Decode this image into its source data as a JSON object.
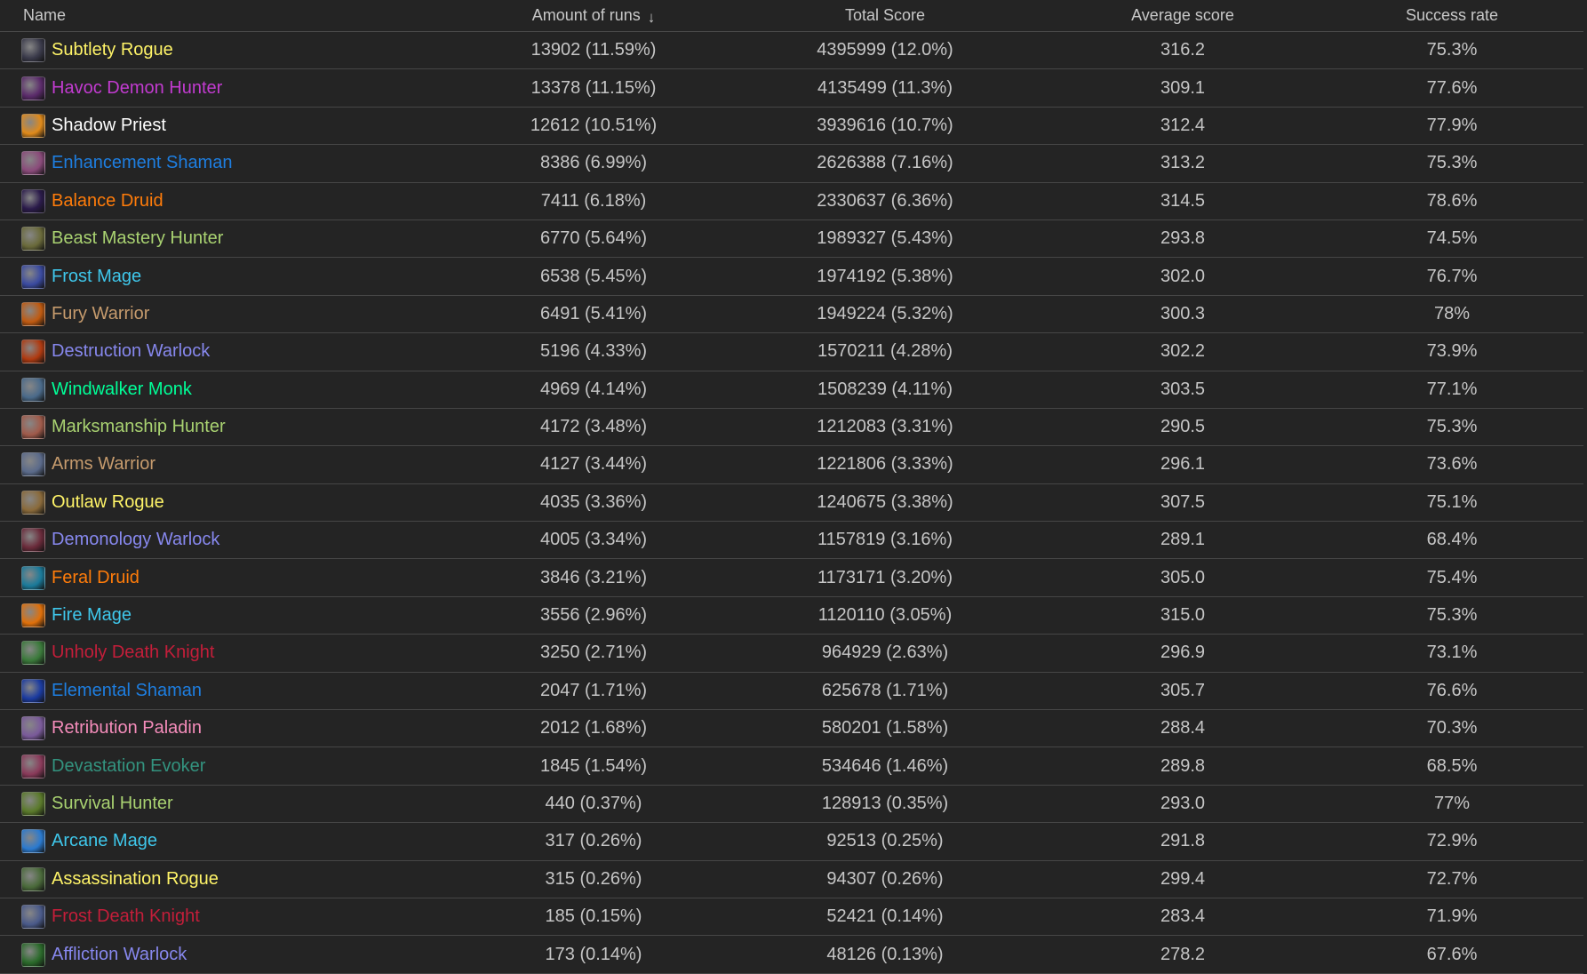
{
  "columns": {
    "name": "Name",
    "runs": "Amount of runs",
    "total": "Total Score",
    "avg": "Average score",
    "success": "Success rate"
  },
  "sort_icon": "arrow-down-icon",
  "rows": [
    {
      "name": "Subtlety Rogue",
      "color": "#fff468",
      "icon": "subtlety-rogue-icon",
      "icon_color": "#3a3a4a",
      "runs": "13902 (11.59%)",
      "total": "4395999 (12.0%)",
      "avg": "316.2",
      "success": "75.3%"
    },
    {
      "name": "Havoc Demon Hunter",
      "color": "#c23bd0",
      "icon": "havoc-demon-hunter-icon",
      "icon_color": "#5a2a6a",
      "runs": "13378 (11.15%)",
      "total": "4135499 (11.3%)",
      "avg": "309.1",
      "success": "77.6%"
    },
    {
      "name": "Shadow Priest",
      "color": "#ffffff",
      "icon": "shadow-priest-icon",
      "icon_color": "#e08a1a",
      "runs": "12612 (10.51%)",
      "total": "3939616 (10.7%)",
      "avg": "312.4",
      "success": "77.9%"
    },
    {
      "name": "Enhancement Shaman",
      "color": "#1e7ee0",
      "icon": "enhancement-shaman-icon",
      "icon_color": "#8a4a7a",
      "runs": "8386 (6.99%)",
      "total": "2626388 (7.16%)",
      "avg": "313.2",
      "success": "75.3%"
    },
    {
      "name": "Balance Druid",
      "color": "#ff7c0a",
      "icon": "balance-druid-icon",
      "icon_color": "#2a1a4a",
      "runs": "7411 (6.18%)",
      "total": "2330637 (6.36%)",
      "avg": "314.5",
      "success": "78.6%"
    },
    {
      "name": "Beast Mastery Hunter",
      "color": "#a9d271",
      "icon": "beast-mastery-hunter-icon",
      "icon_color": "#6a6a3a",
      "runs": "6770 (5.64%)",
      "total": "1989327 (5.43%)",
      "avg": "293.8",
      "success": "74.5%"
    },
    {
      "name": "Frost Mage",
      "color": "#3fc7eb",
      "icon": "frost-mage-icon",
      "icon_color": "#3a4aa0",
      "runs": "6538 (5.45%)",
      "total": "1974192 (5.38%)",
      "avg": "302.0",
      "success": "76.7%"
    },
    {
      "name": "Fury Warrior",
      "color": "#c69b6d",
      "icon": "fury-warrior-icon",
      "icon_color": "#c05a10",
      "runs": "6491 (5.41%)",
      "total": "1949224 (5.32%)",
      "avg": "300.3",
      "success": "78%"
    },
    {
      "name": "Destruction Warlock",
      "color": "#8788ee",
      "icon": "destruction-warlock-icon",
      "icon_color": "#b03a10",
      "runs": "5196 (4.33%)",
      "total": "1570211 (4.28%)",
      "avg": "302.2",
      "success": "73.9%"
    },
    {
      "name": "Windwalker Monk",
      "color": "#00ff98",
      "icon": "windwalker-monk-icon",
      "icon_color": "#4a6a8a",
      "runs": "4969 (4.14%)",
      "total": "1508239 (4.11%)",
      "avg": "303.5",
      "success": "77.1%"
    },
    {
      "name": "Marksmanship Hunter",
      "color": "#a9d271",
      "icon": "marksmanship-hunter-icon",
      "icon_color": "#a05a4a",
      "runs": "4172 (3.48%)",
      "total": "1212083 (3.31%)",
      "avg": "290.5",
      "success": "75.3%"
    },
    {
      "name": "Arms Warrior",
      "color": "#c69b6d",
      "icon": "arms-warrior-icon",
      "icon_color": "#5a6a8a",
      "runs": "4127 (3.44%)",
      "total": "1221806 (3.33%)",
      "avg": "296.1",
      "success": "73.6%"
    },
    {
      "name": "Outlaw Rogue",
      "color": "#fff468",
      "icon": "outlaw-rogue-icon",
      "icon_color": "#8a6a3a",
      "runs": "4035 (3.36%)",
      "total": "1240675 (3.38%)",
      "avg": "307.5",
      "success": "75.1%"
    },
    {
      "name": "Demonology Warlock",
      "color": "#8788ee",
      "icon": "demonology-warlock-icon",
      "icon_color": "#6a2a3a",
      "runs": "4005 (3.34%)",
      "total": "1157819 (3.16%)",
      "avg": "289.1",
      "success": "68.4%"
    },
    {
      "name": "Feral Druid",
      "color": "#ff7c0a",
      "icon": "feral-druid-icon",
      "icon_color": "#1a7a9a",
      "runs": "3846 (3.21%)",
      "total": "1173171 (3.20%)",
      "avg": "305.0",
      "success": "75.4%"
    },
    {
      "name": "Fire Mage",
      "color": "#3fc7eb",
      "icon": "fire-mage-icon",
      "icon_color": "#e0700a",
      "runs": "3556 (2.96%)",
      "total": "1120110 (3.05%)",
      "avg": "315.0",
      "success": "75.3%"
    },
    {
      "name": "Unholy Death Knight",
      "color": "#c41e3a",
      "icon": "unholy-death-knight-icon",
      "icon_color": "#3a7a3a",
      "runs": "3250 (2.71%)",
      "total": "964929 (2.63%)",
      "avg": "296.9",
      "success": "73.1%"
    },
    {
      "name": "Elemental Shaman",
      "color": "#1e7ee0",
      "icon": "elemental-shaman-icon",
      "icon_color": "#1a3aa0",
      "runs": "2047 (1.71%)",
      "total": "625678 (1.71%)",
      "avg": "305.7",
      "success": "76.6%"
    },
    {
      "name": "Retribution Paladin",
      "color": "#f48cba",
      "icon": "retribution-paladin-icon",
      "icon_color": "#7a5a9a",
      "runs": "2012 (1.68%)",
      "total": "580201 (1.58%)",
      "avg": "288.4",
      "success": "70.3%"
    },
    {
      "name": "Devastation Evoker",
      "color": "#33937f",
      "icon": "devastation-evoker-icon",
      "icon_color": "#8a3a5a",
      "runs": "1845 (1.54%)",
      "total": "534646 (1.46%)",
      "avg": "289.8",
      "success": "68.5%"
    },
    {
      "name": "Survival Hunter",
      "color": "#a9d271",
      "icon": "survival-hunter-icon",
      "icon_color": "#5a7a2a",
      "runs": "440 (0.37%)",
      "total": "128913 (0.35%)",
      "avg": "293.0",
      "success": "77%"
    },
    {
      "name": "Arcane Mage",
      "color": "#3fc7eb",
      "icon": "arcane-mage-icon",
      "icon_color": "#2a7ad0",
      "runs": "317 (0.26%)",
      "total": "92513 (0.25%)",
      "avg": "291.8",
      "success": "72.9%"
    },
    {
      "name": "Assassination Rogue",
      "color": "#fff468",
      "icon": "assassination-rogue-icon",
      "icon_color": "#4a6a3a",
      "runs": "315 (0.26%)",
      "total": "94307 (0.26%)",
      "avg": "299.4",
      "success": "72.7%"
    },
    {
      "name": "Frost Death Knight",
      "color": "#c41e3a",
      "icon": "frost-death-knight-icon",
      "icon_color": "#4a5a8a",
      "runs": "185 (0.15%)",
      "total": "52421 (0.14%)",
      "avg": "283.4",
      "success": "71.9%"
    },
    {
      "name": "Affliction Warlock",
      "color": "#8788ee",
      "icon": "affliction-warlock-icon",
      "icon_color": "#2a6a2a",
      "runs": "173 (0.14%)",
      "total": "48126 (0.13%)",
      "avg": "278.2",
      "success": "67.6%"
    }
  ]
}
